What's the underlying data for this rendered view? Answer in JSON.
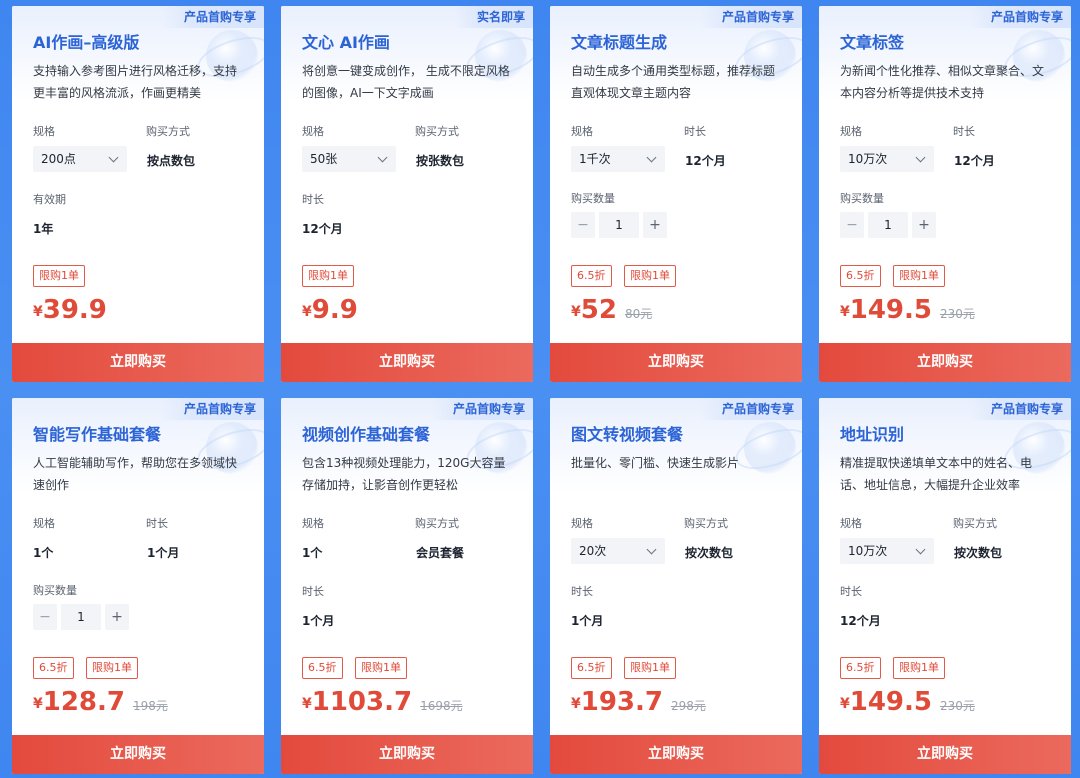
{
  "ribbon_default": "产品首购专享",
  "labels": {
    "spec": "规格",
    "buy_method": "购买方式",
    "validity": "有效期",
    "duration": "时长",
    "quantity": "购买数量",
    "limit_tag": "限购1单",
    "discount_tag": "6.5折",
    "buy_button": "立即购买",
    "currency": "¥",
    "minus": "−",
    "plus": "+"
  },
  "cards": [
    {
      "ribbon": "产品首购专享",
      "title": "AI作画–高级版",
      "desc": "支持输入参考图片进行风格迁移，支持更丰富的风格流派，作画更精美",
      "spec_value": "200点",
      "buy_method_value": "按点数包",
      "validity_value": "1年",
      "price": "39.9"
    },
    {
      "ribbon": "实名即享",
      "title": "文心 AI作画",
      "desc": "将创意一键变成创作， 生成不限定风格的图像，AI一下文字成画",
      "spec_value": "50张",
      "buy_method_value": "按张数包",
      "duration_value": "12个月",
      "price": "9.9"
    },
    {
      "ribbon": "产品首购专享",
      "title": "文章标题生成",
      "desc": "自动生成多个通用类型标题，推荐标题直观体现文章主题内容",
      "spec_value": "1千次",
      "duration_value": "12个月",
      "quantity_value": "1",
      "price": "52",
      "original_price": "80元"
    },
    {
      "ribbon": "产品首购专享",
      "title": "文章标签",
      "desc": "为新闻个性化推荐、相似文章聚合、文本内容分析等提供技术支持",
      "spec_value": "10万次",
      "duration_value": "12个月",
      "quantity_value": "1",
      "price": "149.5",
      "original_price": "230元"
    },
    {
      "ribbon": "产品首购专享",
      "title": "智能写作基础套餐",
      "desc": "人工智能辅助写作，帮助您在多领域快速创作",
      "spec_value": "1个",
      "duration_value": "1个月",
      "quantity_value": "1",
      "price": "128.7",
      "original_price": "198元"
    },
    {
      "ribbon": "产品首购专享",
      "title": "视频创作基础套餐",
      "desc": "包含13种视频处理能力，120G大容量存储加持，让影音创作更轻松",
      "spec_value": "1个",
      "buy_method_value": "会员套餐",
      "duration_value": "1个月",
      "price": "1103.7",
      "original_price": "1698元"
    },
    {
      "ribbon": "产品首购专享",
      "title": "图文转视频套餐",
      "desc": "批量化、零门槛、快速生成影片",
      "spec_value": "20次",
      "buy_method_value": "按次数包",
      "duration_value": "1个月",
      "price": "193.7",
      "original_price": "298元"
    },
    {
      "ribbon": "产品首购专享",
      "title": "地址识别",
      "desc": "精准提取快递填单文本中的姓名、电话、地址信息，大幅提升企业效率",
      "spec_value": "10万次",
      "buy_method_value": "按次数包",
      "duration_value": "12个月",
      "price": "149.5",
      "original_price": "230元"
    }
  ]
}
